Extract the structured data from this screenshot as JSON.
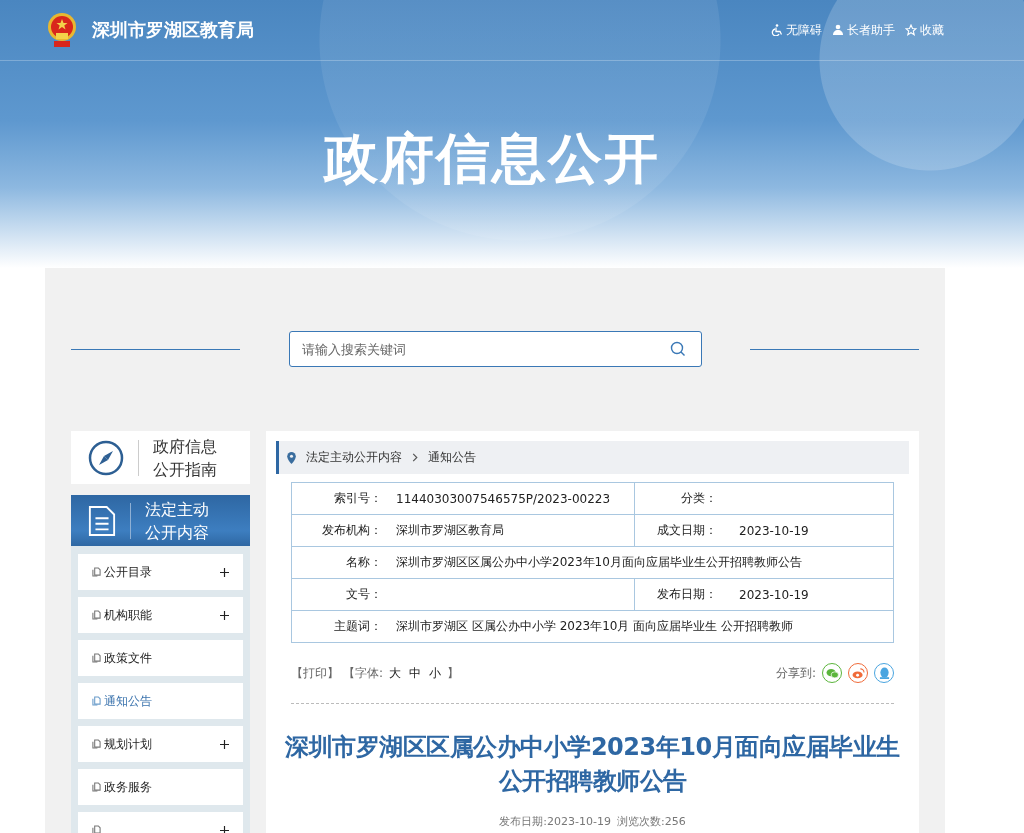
{
  "header": {
    "site_title": "深圳市罗湖区教育局",
    "links": [
      {
        "kind": "accessibility",
        "label": "无障碍"
      },
      {
        "kind": "elder",
        "label": "长者助手"
      },
      {
        "kind": "favorite",
        "label": "收藏"
      }
    ]
  },
  "banner_title": "政府信息公开",
  "search": {
    "placeholder": "请输入搜索关键词"
  },
  "sidebar": {
    "guide": {
      "label": "政府信息公开指南"
    },
    "section": {
      "label": "法定主动公开内容"
    },
    "items": [
      {
        "label": "公开目录",
        "selected": false,
        "expandable": true
      },
      {
        "label": "机构职能",
        "selected": false,
        "expandable": true
      },
      {
        "label": "政策文件",
        "selected": false,
        "expandable": false
      },
      {
        "label": "通知公告",
        "selected": true,
        "expandable": false
      },
      {
        "label": "规划计划",
        "selected": false,
        "expandable": true
      },
      {
        "label": "政务服务",
        "selected": false,
        "expandable": false
      },
      {
        "selected": false,
        "expandable": true
      }
    ]
  },
  "breadcrumb": [
    "法定主动公开内容",
    "通知公告"
  ],
  "info_table": [
    {
      "cells": [
        {
          "label": "索引号：",
          "value": "11440303007546575P/2023-00223"
        },
        {
          "label": "分类："
        }
      ]
    },
    {
      "cells": [
        {
          "label": "发布机构：",
          "value": "深圳市罗湖区教育局"
        },
        {
          "label": "成文日期：",
          "value": "2023-10-19"
        }
      ]
    },
    {
      "cells": [
        {
          "label": "名称：",
          "value": "深圳市罗湖区区属公办中小学2023年10月面向应届毕业生公开招聘教师公告"
        }
      ]
    },
    {
      "cells": [
        {
          "label": "文号："
        },
        {
          "label": "发布日期：",
          "value": "2023-10-19"
        }
      ]
    },
    {
      "cells": [
        {
          "label": "主题词：",
          "value": "深圳市罗湖区 区属公办中小学 2023年10月 面向应届毕业生 公开招聘教师"
        }
      ]
    }
  ],
  "tools": {
    "print": "【打印】",
    "font_prefix": "【字体:",
    "font_sizes": [
      "大",
      "中",
      "小"
    ],
    "font_suffix": "】"
  },
  "share": {
    "label": "分享到:",
    "targets": [
      {
        "kind": "wechat"
      },
      {
        "kind": "weibo"
      },
      {
        "kind": "qq"
      }
    ]
  },
  "article": {
    "title": "深圳市罗湖区区属公办中小学2023年10月面向应届毕业生公开招聘教师公告",
    "meta": [
      "发布日期:2023-10-19",
      "浏览次数:256"
    ]
  }
}
